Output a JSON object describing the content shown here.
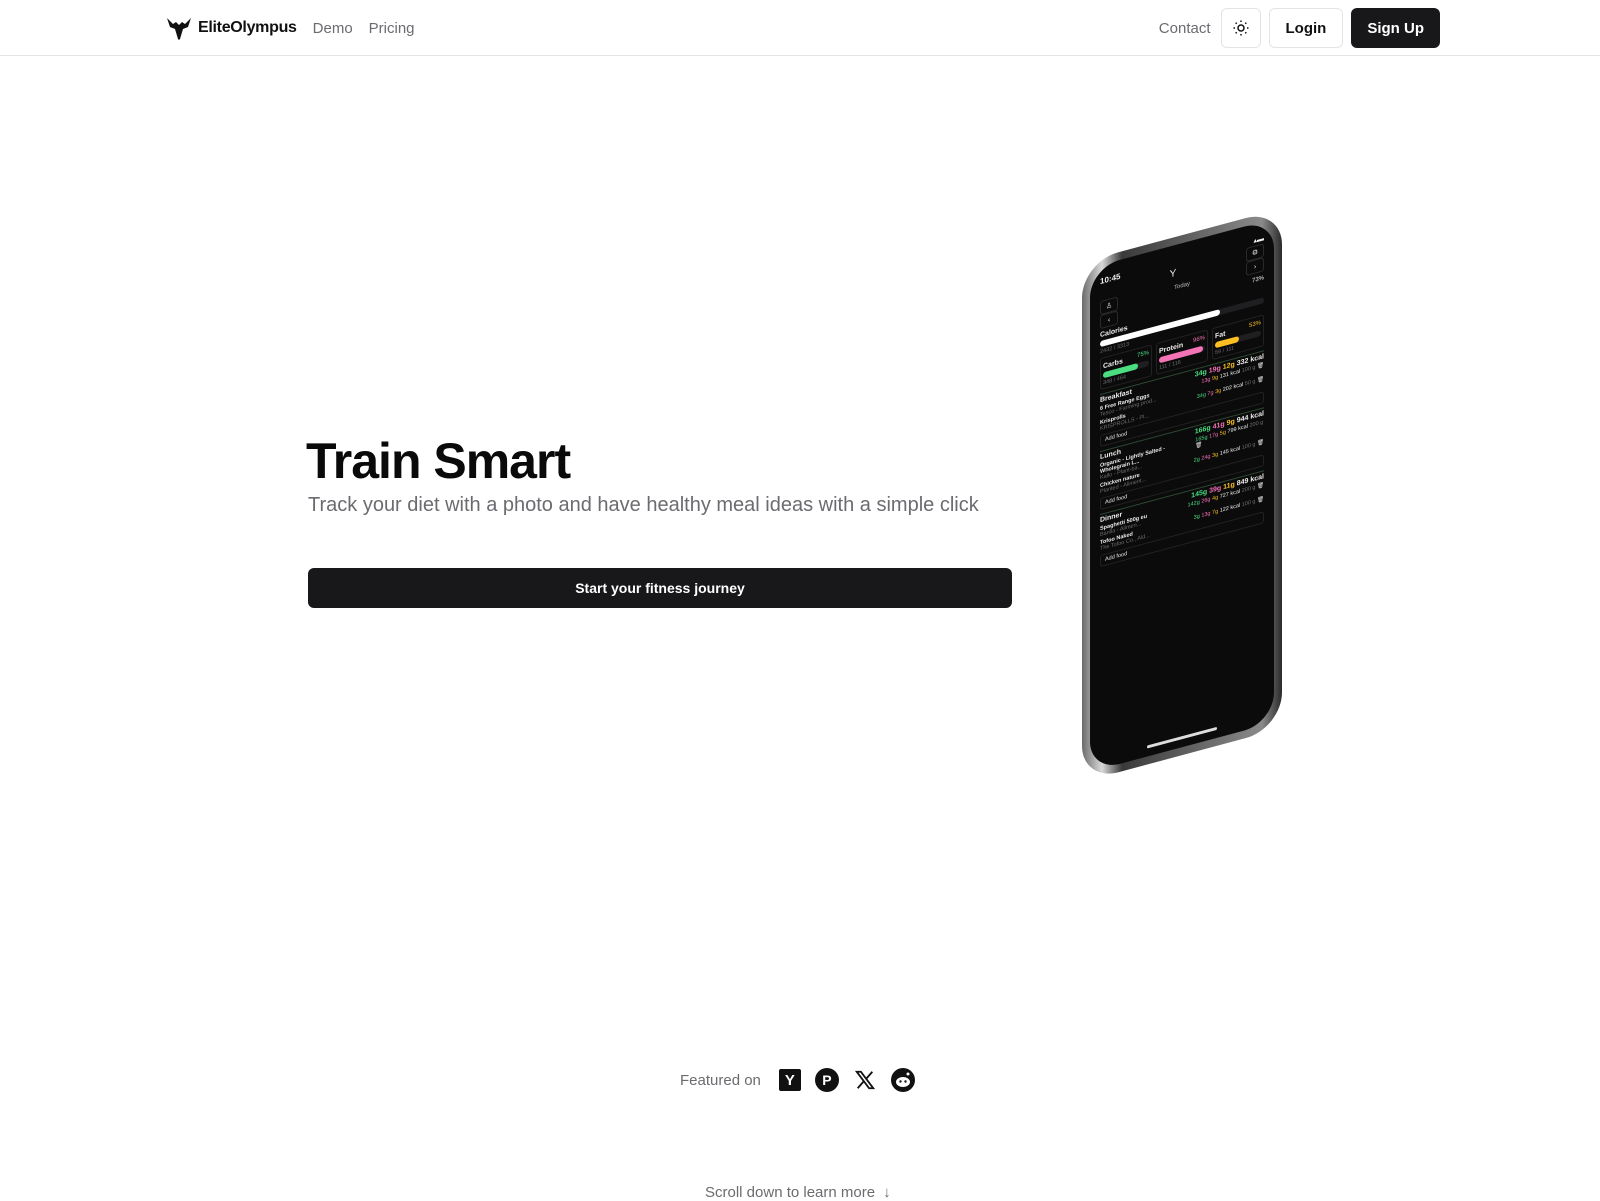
{
  "nav": {
    "brand": "EliteOlympus",
    "links": [
      "Demo",
      "Pricing"
    ],
    "contact": "Contact",
    "theme_icon": "sun-icon",
    "login": "Login",
    "signup": "Sign Up"
  },
  "hero": {
    "title": "Train Smart",
    "subtitle": "Track your diet with a photo and have healthy meal ideas with a simple click",
    "cta": "Start your fitness journey"
  },
  "phone": {
    "time": "10:45",
    "day": "Today",
    "calories": {
      "label": "Calories",
      "pct": "73%",
      "value": "2432 / 3313",
      "fraction": 0.73,
      "color": "#ffffff"
    },
    "macros": [
      {
        "label": "Carbs",
        "pct": "75%",
        "value": "348 / 464",
        "fraction": 0.75,
        "color": "#4ade80"
      },
      {
        "label": "Protein",
        "pct": "96%",
        "value": "111 / 116",
        "fraction": 0.96,
        "color": "#f472b6"
      },
      {
        "label": "Fat",
        "pct": "53%",
        "value": "59 / 111",
        "fraction": 0.53,
        "color": "#fbbf24"
      }
    ],
    "meals": [
      {
        "name": "Breakfast",
        "carbs": "34g",
        "protein": "19g",
        "fat": "12g",
        "kcal": "332 kcal",
        "foods": [
          {
            "name": "6 Free Range Eggs",
            "brand": "Tesco - Farming prod...",
            "carbs": "",
            "protein": "13g",
            "fat": "9g",
            "kcal": "131 kcal",
            "qty": "100 g"
          },
          {
            "name": "Krisprolls",
            "brand": "KRISPROLLS - Pl...",
            "carbs": "34g",
            "protein": "7g",
            "fat": "3g",
            "kcal": "202 kcal",
            "qty": "50 g"
          }
        ],
        "add": "Add food"
      },
      {
        "name": "Lunch",
        "carbs": "166g",
        "protein": "41g",
        "fat": "9g",
        "kcal": "944 kcal",
        "foods": [
          {
            "name": "Organic - Lightly Salted - Wholegrain L...",
            "brand": "Kallo - Plant-ba...",
            "carbs": "165g",
            "protein": "17g",
            "fat": "5g",
            "kcal": "799 kcal",
            "qty": "200 g"
          },
          {
            "name": "Chicken nature",
            "brand": "Planted - Aliment...",
            "carbs": "2g",
            "protein": "24g",
            "fat": "3g",
            "kcal": "145 kcal",
            "qty": "100 g"
          }
        ],
        "add": "Add food"
      },
      {
        "name": "Dinner",
        "carbs": "145g",
        "protein": "39g",
        "fat": "11g",
        "kcal": "849 kcal",
        "foods": [
          {
            "name": "Spaghetti 500g eu",
            "brand": "Barilla - Alimen...",
            "carbs": "142g",
            "protein": "26g",
            "fat": "4g",
            "kcal": "727 kcal",
            "qty": "200 g"
          },
          {
            "name": "Tofoo Naked",
            "brand": "The Tofoo Co., Ald...",
            "carbs": "3g",
            "protein": "13g",
            "fat": "7g",
            "kcal": "122 kcal",
            "qty": "100 g"
          }
        ],
        "add": "Add food"
      }
    ]
  },
  "featured": {
    "label": "Featured on",
    "icons": [
      "ycombinator-icon",
      "producthunt-icon",
      "x-icon",
      "reddit-icon"
    ]
  },
  "scroll_hint": "Scroll down to learn more",
  "colors": {
    "primary": "#18181b",
    "muted_text": "#6b6b70",
    "border": "#e4e4e7"
  }
}
